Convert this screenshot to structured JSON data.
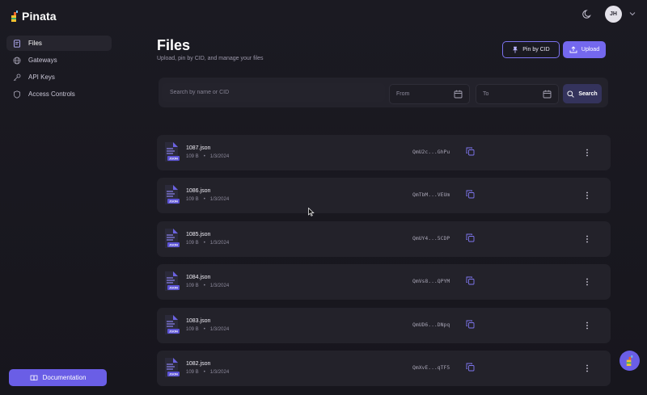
{
  "brand": {
    "name": "Pinata"
  },
  "sidebar": {
    "items": [
      {
        "label": "Files",
        "icon": "file-icon",
        "active": true
      },
      {
        "label": "Gateways",
        "icon": "globe-icon",
        "active": false
      },
      {
        "label": "API Keys",
        "icon": "key-icon",
        "active": false
      },
      {
        "label": "Access Controls",
        "icon": "shield-icon",
        "active": false
      }
    ],
    "documentation_label": "Documentation"
  },
  "user": {
    "initials": "JH"
  },
  "header": {
    "title": "Files",
    "subtitle": "Upload, pin by CID, and manage your files",
    "pin_label": "Pin by CID",
    "upload_label": "Upload"
  },
  "search": {
    "placeholder": "Search by name or CID",
    "from_label": "From",
    "to_label": "To",
    "button_label": "Search"
  },
  "files": [
    {
      "name": "1087.json",
      "size": "109 B",
      "date": "1/3/2024",
      "cid": "QmU2c...GhPu"
    },
    {
      "name": "1086.json",
      "size": "109 B",
      "date": "1/3/2024",
      "cid": "QmTbM...VEUm"
    },
    {
      "name": "1085.json",
      "size": "109 B",
      "date": "1/3/2024",
      "cid": "QmUY4...5CDP"
    },
    {
      "name": "1084.json",
      "size": "109 B",
      "date": "1/3/2024",
      "cid": "QmVs8...QPYM"
    },
    {
      "name": "1083.json",
      "size": "109 B",
      "date": "1/3/2024",
      "cid": "QmUD6...DNpq"
    },
    {
      "name": "1082.json",
      "size": "109 B",
      "date": "1/3/2024",
      "cid": "QmXvE...qTF5"
    }
  ],
  "file_badge": "JSON",
  "meta_separator": "•",
  "colors": {
    "accent": "#7468ee",
    "background": "#18171f",
    "card": "#23222a"
  }
}
